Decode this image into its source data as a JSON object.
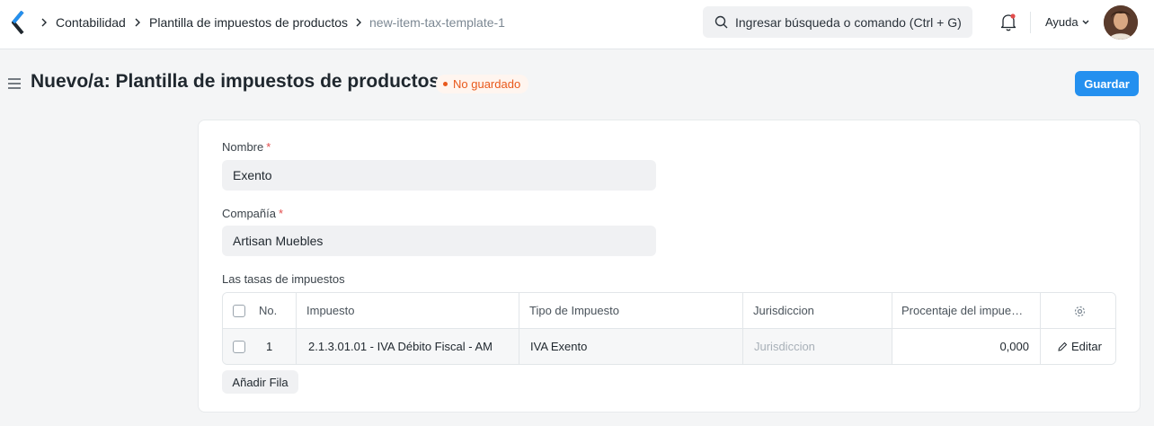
{
  "breadcrumbs": [
    "Contabilidad",
    "Plantilla de impuestos de productos",
    "new-item-tax-template-1"
  ],
  "search": {
    "placeholder": "Ingresar búsqueda o comando (Ctrl + G)"
  },
  "navbar": {
    "help_label": "Ayuda"
  },
  "page": {
    "title": "Nuevo/a: Plantilla de impuestos de productos",
    "status_badge": "No guardado",
    "save_label": "Guardar"
  },
  "form": {
    "name_label": "Nombre",
    "name_value": "Exento",
    "company_label": "Compañía",
    "company_value": "Artisan Muebles",
    "required_mark": "*",
    "tax_rates_label": "Las tasas de impuestos"
  },
  "table": {
    "columns": [
      "No.",
      "Impuesto",
      "Tipo de Impuesto",
      "Jurisdiccion",
      "Procentaje del impue…"
    ],
    "rows": [
      {
        "no": "1",
        "tax": "2.1.3.01.01 - IVA Débito Fiscal - AM",
        "tax_type": "IVA Exento",
        "jurisdiction_placeholder": "Jurisdiccion",
        "rate": "0,000",
        "edit_label": "Editar"
      }
    ],
    "add_row_label": "Añadir Fila"
  },
  "colors": {
    "accent": "#2490ef",
    "badge": "#e8591c",
    "required": "#e24c4c"
  }
}
